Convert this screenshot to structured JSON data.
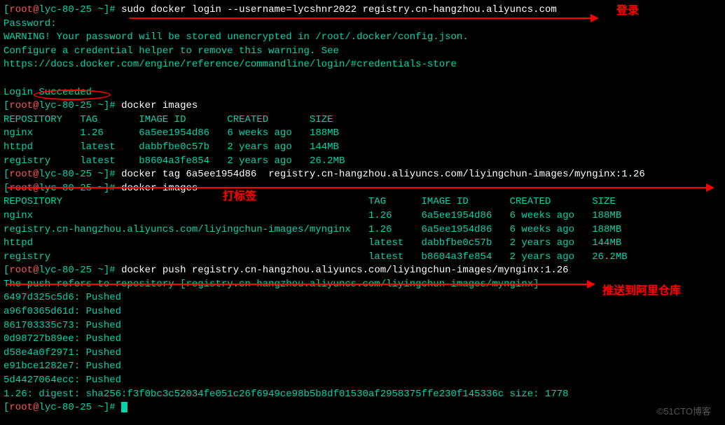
{
  "prompt": {
    "user": "root",
    "host": "lyc-80-25",
    "path": "~",
    "symbol": "#"
  },
  "cmd1": "sudo docker login --username=lycshnr2022 registry.cn-hangzhou.aliyuncs.com",
  "login_output": {
    "password": "Password:",
    "warning1": "WARNING! Your password will be stored unencrypted in /root/.docker/config.json.",
    "warning2": "Configure a credential helper to remove this warning. See",
    "warning3": "https://docs.docker.com/engine/reference/commandline/login/#credentials-store",
    "success": "Login Succeeded"
  },
  "cmd2": "docker images",
  "table1": {
    "headers": [
      "REPOSITORY",
      "TAG",
      "IMAGE ID",
      "CREATED",
      "SIZE"
    ],
    "rows": [
      [
        "nginx",
        "1.26",
        "6a5ee1954d86",
        "6 weeks ago",
        "188MB"
      ],
      [
        "httpd",
        "latest",
        "dabbfbe0c57b",
        "2 years ago",
        "144MB"
      ],
      [
        "registry",
        "latest",
        "b8604a3fe854",
        "2 years ago",
        "26.2MB"
      ]
    ]
  },
  "cmd3": "docker tag 6a5ee1954d86  registry.cn-hangzhou.aliyuncs.com/liyingchun-images/mynginx:1.26",
  "cmd4": "docker images",
  "table2": {
    "headers": [
      "REPOSITORY",
      "TAG",
      "IMAGE ID",
      "CREATED",
      "SIZE"
    ],
    "rows": [
      [
        "nginx",
        "1.26",
        "6a5ee1954d86",
        "6 weeks ago",
        "188MB"
      ],
      [
        "registry.cn-hangzhou.aliyuncs.com/liyingchun-images/mynginx",
        "1.26",
        "6a5ee1954d86",
        "6 weeks ago",
        "188MB"
      ],
      [
        "httpd",
        "latest",
        "dabbfbe0c57b",
        "2 years ago",
        "144MB"
      ],
      [
        "registry",
        "latest",
        "b8604a3fe854",
        "2 years ago",
        "26.2MB"
      ]
    ]
  },
  "cmd5": "docker push registry.cn-hangzhou.aliyuncs.com/liyingchun-images/mynginx:1.26",
  "push_output": {
    "refers": "The push refers to repository [registry.cn-hangzhou.aliyuncs.com/liyingchun-images/mynginx]",
    "layers": [
      "6497d325c5d6: Pushed",
      "a96f0365d61d: Pushed",
      "861703335c73: Pushed",
      "0d98727b89ee: Pushed",
      "d58e4a0f2971: Pushed",
      "e91bce1282e7: Pushed",
      "5d4427064ecc: Pushed"
    ],
    "digest": "1.26: digest: sha256:f3f0bc3c52034fe051c26f6949ce98b5b8df01530af2958375ffe230f145336c size: 1778"
  },
  "annotations": {
    "login": "登录",
    "tag": "打标签",
    "push": "推送到阿里仓库"
  },
  "watermark": "©51CTO博客"
}
